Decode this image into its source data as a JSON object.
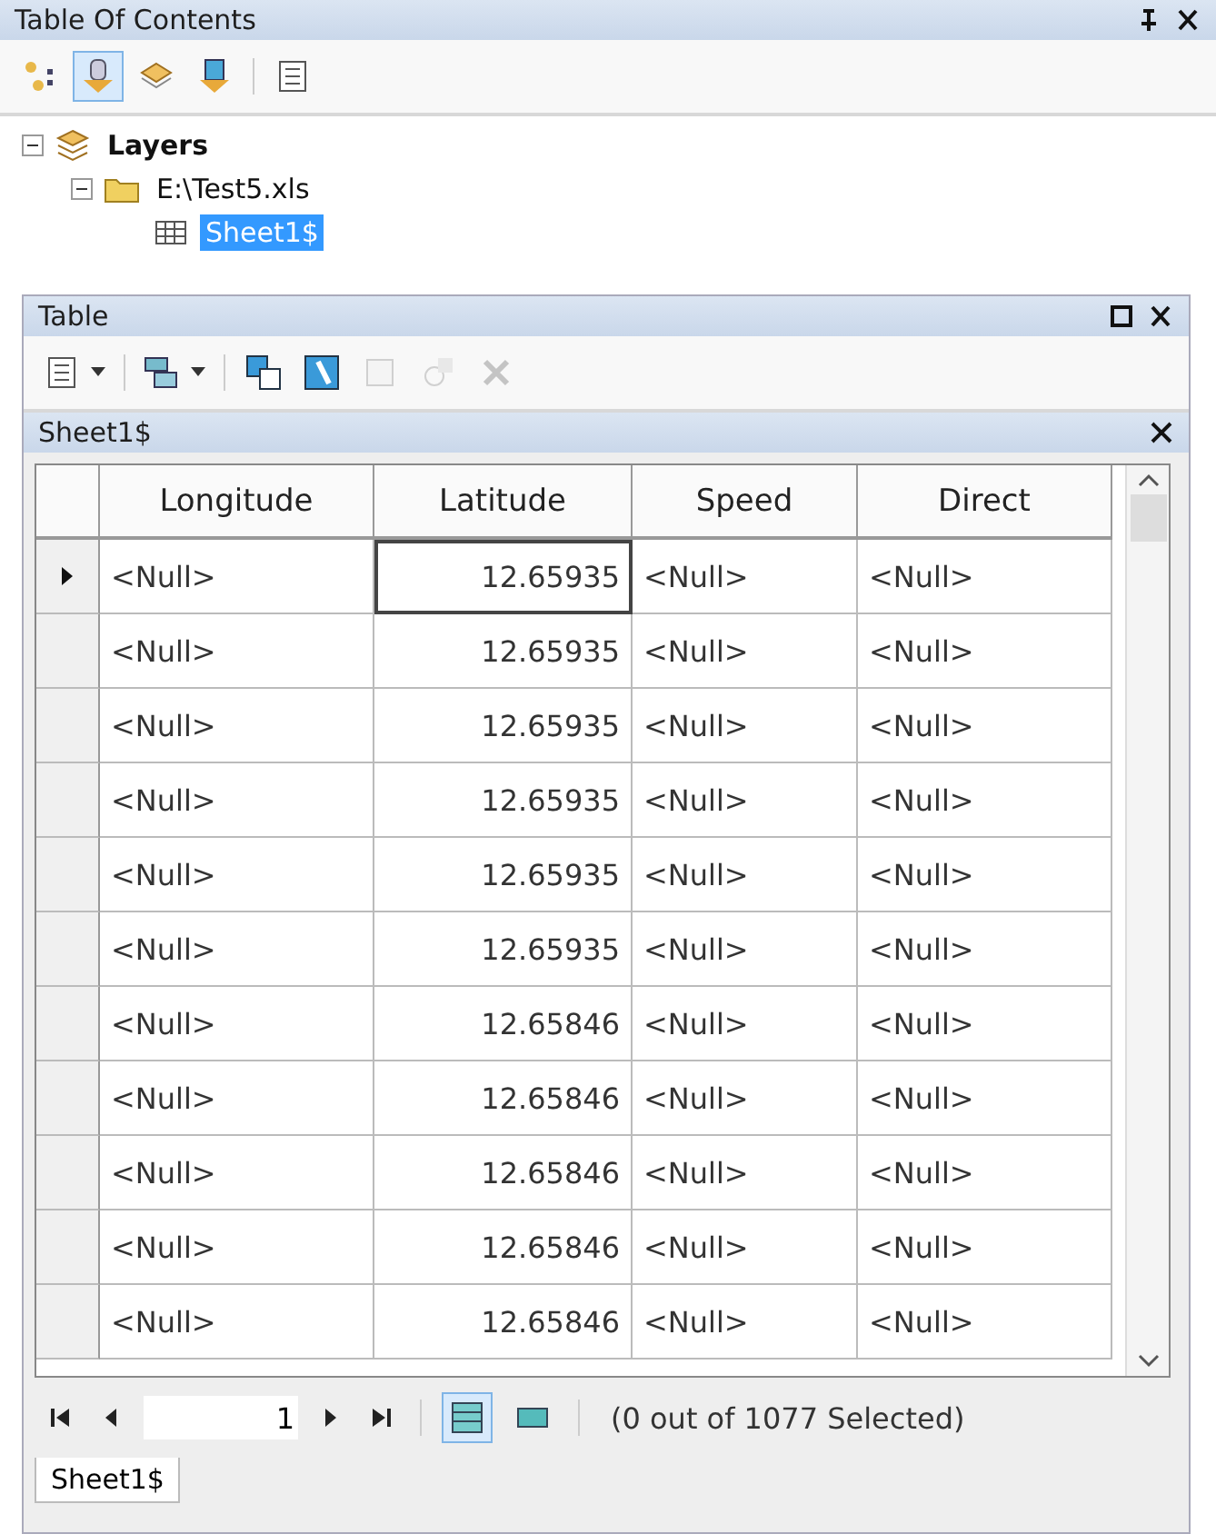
{
  "toc": {
    "title": "Table Of Contents",
    "toolbar": [
      {
        "kind": "list-drawing",
        "selected": false
      },
      {
        "kind": "source",
        "selected": true
      },
      {
        "kind": "visibility",
        "selected": false
      },
      {
        "kind": "selection",
        "selected": false
      },
      {
        "kind": "options",
        "selected": false
      }
    ],
    "tree": [
      {
        "label": "Layers",
        "kind": "layers",
        "expanded": true,
        "selected": false,
        "children": [
          {
            "label": "E:\\Test5.xls",
            "kind": "folder",
            "expanded": true,
            "selected": false,
            "children": [
              {
                "label": "Sheet1$",
                "kind": "table",
                "selected": true
              }
            ]
          }
        ]
      }
    ]
  },
  "table_window": {
    "title": "Table",
    "toolbar": [
      {
        "kind": "options",
        "dropdown": true,
        "disabled": false
      },
      {
        "kind": "related",
        "dropdown": true,
        "disabled": false
      },
      {
        "kind": "select-by",
        "dropdown": false,
        "disabled": false
      },
      {
        "kind": "switch",
        "dropdown": false,
        "disabled": false
      },
      {
        "kind": "clear",
        "dropdown": false,
        "disabled": true
      },
      {
        "kind": "zoom",
        "dropdown": false,
        "disabled": true
      },
      {
        "kind": "delete",
        "dropdown": false,
        "disabled": true
      }
    ],
    "sheet_title": "Sheet1$",
    "columns": [
      "Longitude",
      "Latitude",
      "Speed",
      "Direct"
    ],
    "rows": [
      {
        "current": true,
        "cells": [
          "<Null>",
          "12.65935",
          "<Null>",
          "<Null>"
        ]
      },
      {
        "current": false,
        "cells": [
          "<Null>",
          "12.65935",
          "<Null>",
          "<Null>"
        ]
      },
      {
        "current": false,
        "cells": [
          "<Null>",
          "12.65935",
          "<Null>",
          "<Null>"
        ]
      },
      {
        "current": false,
        "cells": [
          "<Null>",
          "12.65935",
          "<Null>",
          "<Null>"
        ]
      },
      {
        "current": false,
        "cells": [
          "<Null>",
          "12.65935",
          "<Null>",
          "<Null>"
        ]
      },
      {
        "current": false,
        "cells": [
          "<Null>",
          "12.65935",
          "<Null>",
          "<Null>"
        ]
      },
      {
        "current": false,
        "cells": [
          "<Null>",
          "12.65846",
          "<Null>",
          "<Null>"
        ]
      },
      {
        "current": false,
        "cells": [
          "<Null>",
          "12.65846",
          "<Null>",
          "<Null>"
        ]
      },
      {
        "current": false,
        "cells": [
          "<Null>",
          "12.65846",
          "<Null>",
          "<Null>"
        ]
      },
      {
        "current": false,
        "cells": [
          "<Null>",
          "12.65846",
          "<Null>",
          "<Null>"
        ]
      },
      {
        "current": false,
        "cells": [
          "<Null>",
          "12.65846",
          "<Null>",
          "<Null>"
        ]
      }
    ],
    "record": "1",
    "views": [
      {
        "kind": "all",
        "selected": true
      },
      {
        "kind": "selected",
        "selected": false
      }
    ],
    "status": "(0 out of 1077 Selected)",
    "tabs": [
      {
        "label": "Sheet1$",
        "selected": true
      }
    ]
  }
}
